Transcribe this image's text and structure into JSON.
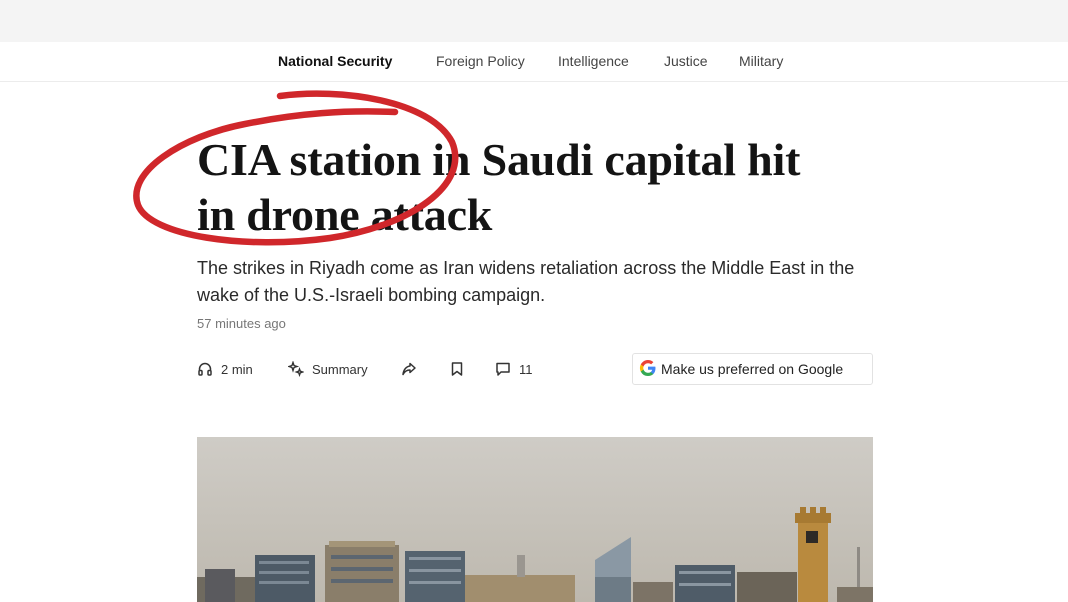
{
  "nav": {
    "items": [
      {
        "label": "National Security",
        "active": true
      },
      {
        "label": "Foreign Policy",
        "active": false
      },
      {
        "label": "Intelligence",
        "active": false
      },
      {
        "label": "Justice",
        "active": false
      },
      {
        "label": "Military",
        "active": false
      }
    ]
  },
  "article": {
    "headline_line1": "CIA station in Saudi capital hit",
    "headline_line2": "in drone attack",
    "dek": "The strikes in Riyadh come as Iran widens retaliation across the Middle East in the wake of the U.S.-Israeli bombing campaign.",
    "timestamp": "57 minutes ago"
  },
  "actions": {
    "listen_label": "2 min",
    "summary_label": "Summary",
    "comments_count": "11",
    "google_label": "Make us preferred on Google"
  },
  "icons": {
    "listen": "headphones-icon",
    "summary": "sparkle-icon",
    "share": "share-icon",
    "bookmark": "bookmark-icon",
    "comments": "comment-icon",
    "google": "google-g-icon"
  },
  "colors": {
    "annotation_red": "#d0272b",
    "active_nav": "#111111",
    "nav_text": "#444444"
  }
}
